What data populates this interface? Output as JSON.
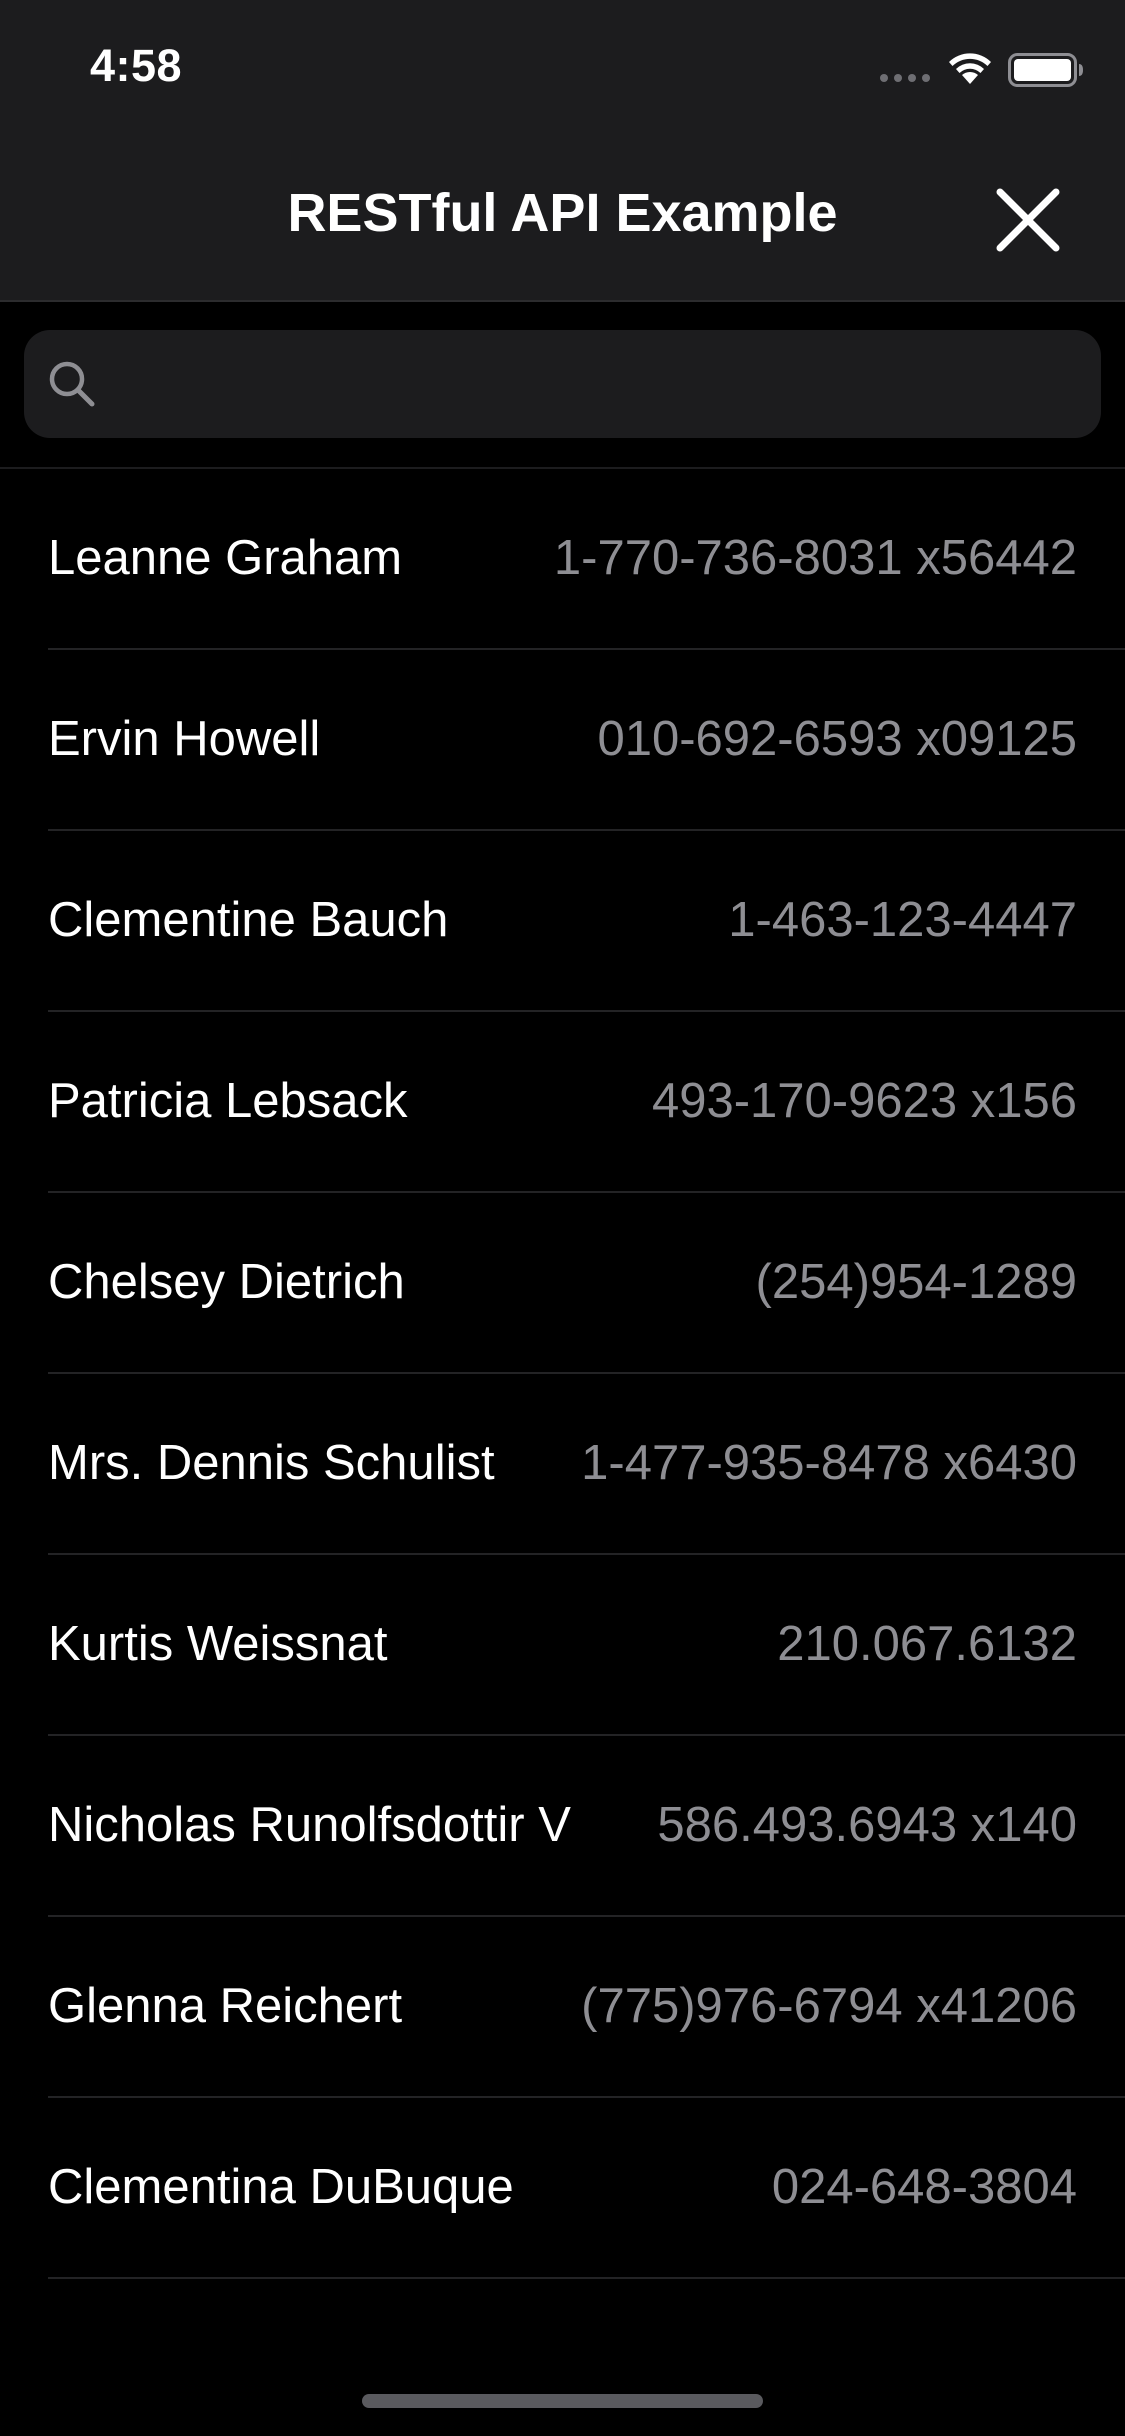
{
  "status_bar": {
    "time": "4:58"
  },
  "nav": {
    "title": "RESTful API Example",
    "close_icon": "close-icon"
  },
  "search": {
    "placeholder": "",
    "value": "",
    "icon": "search-icon"
  },
  "contacts": [
    {
      "name": "Leanne Graham",
      "phone": "1-770-736-8031 x56442"
    },
    {
      "name": "Ervin Howell",
      "phone": "010-692-6593 x09125"
    },
    {
      "name": "Clementine Bauch",
      "phone": "1-463-123-4447"
    },
    {
      "name": "Patricia Lebsack",
      "phone": "493-170-9623 x156"
    },
    {
      "name": "Chelsey Dietrich",
      "phone": "(254)954-1289"
    },
    {
      "name": "Mrs. Dennis Schulist",
      "phone": "1-477-935-8478 x6430"
    },
    {
      "name": "Kurtis Weissnat",
      "phone": "210.067.6132"
    },
    {
      "name": "Nicholas Runolfsdottir V",
      "phone": "586.493.6943 x140"
    },
    {
      "name": "Glenna Reichert",
      "phone": "(775)976-6794 x41206"
    },
    {
      "name": "Clementina DuBuque",
      "phone": "024-648-3804"
    }
  ],
  "colors": {
    "background": "#000000",
    "bar_background": "#1c1c1e",
    "primary_text": "#ffffff",
    "secondary_text": "#8e8e93"
  }
}
